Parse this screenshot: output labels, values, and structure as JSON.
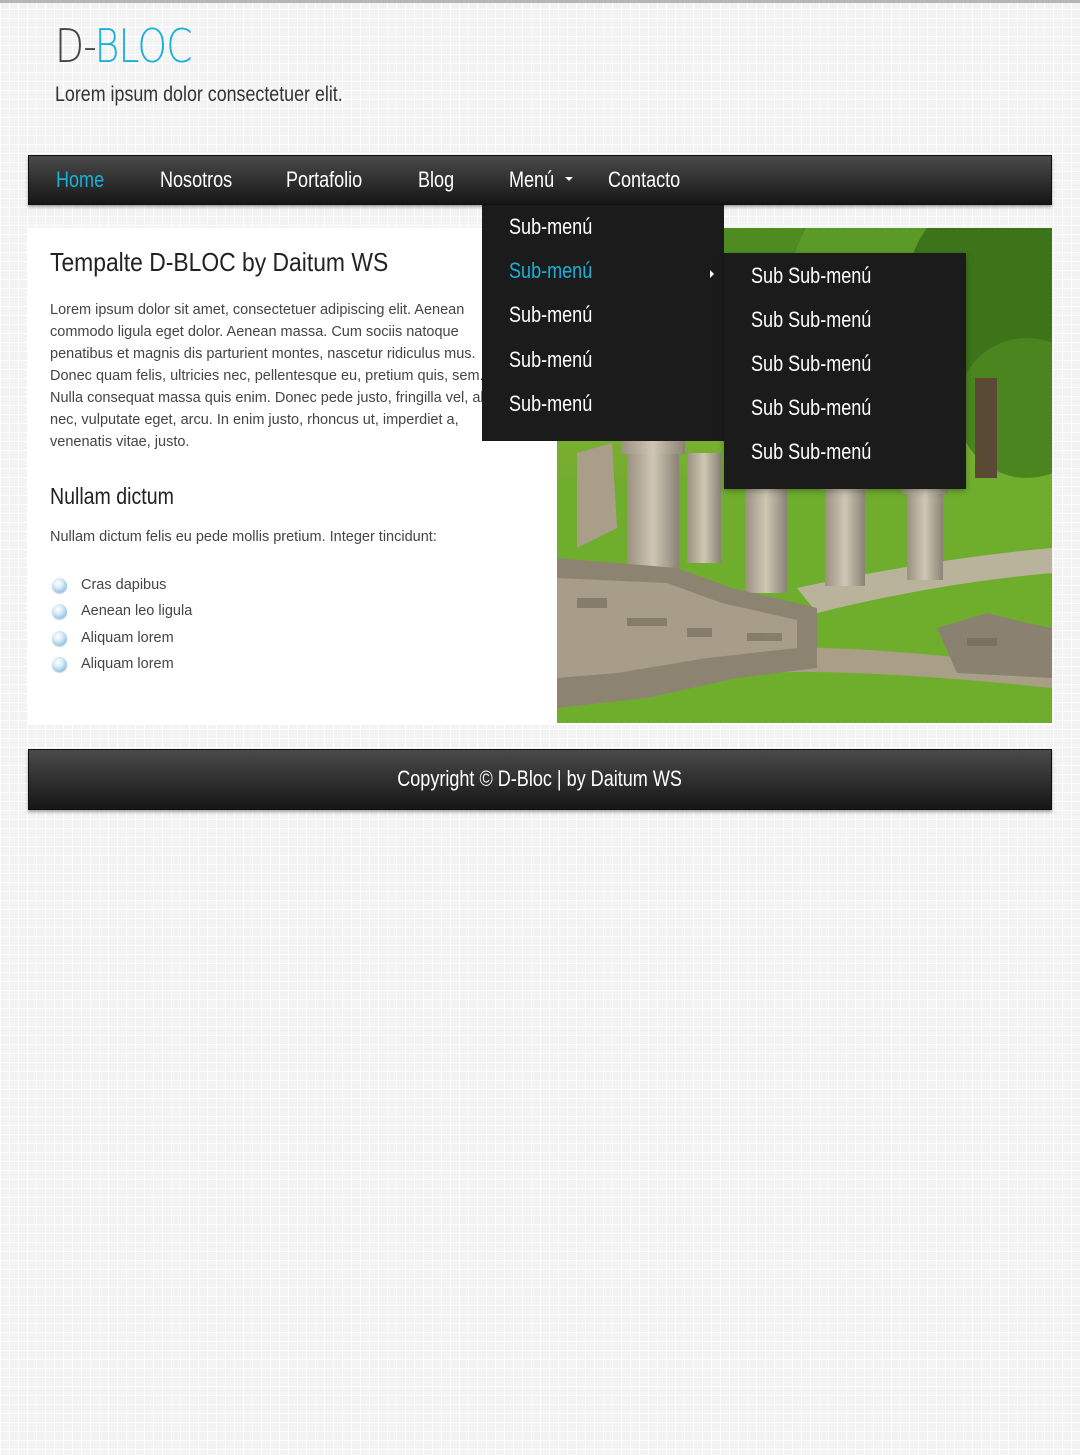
{
  "header": {
    "title_prefix": "D-",
    "title_accent": "BLOC",
    "tagline": "Lorem ipsum dolor consectetuer elit.",
    "accent_color": "#1ab0d8"
  },
  "nav": {
    "items": [
      {
        "label": "Home"
      },
      {
        "label": "Nosotros"
      },
      {
        "label": "Portafolio"
      },
      {
        "label": "Blog"
      },
      {
        "label": "Menú"
      },
      {
        "label": "Contacto"
      }
    ],
    "dropdown": [
      {
        "label": "Sub-menú"
      },
      {
        "label": "Sub-menú"
      },
      {
        "label": "Sub-menú"
      },
      {
        "label": "Sub-menú"
      },
      {
        "label": "Sub-menú"
      }
    ],
    "subdropdown": [
      {
        "label": "Sub Sub-menú"
      },
      {
        "label": "Sub Sub-menú"
      },
      {
        "label": "Sub Sub-menú"
      },
      {
        "label": "Sub Sub-menú"
      },
      {
        "label": "Sub Sub-menú"
      }
    ]
  },
  "main": {
    "title": "Tempalte D-BLOC by Daitum WS",
    "body": "Lorem ipsum dolor sit amet, consectetuer adipiscing elit. Aenean commodo ligula eget dolor. Aenean massa. Cum sociis natoque penatibus et magnis dis parturient montes, nascetur ridiculus mus. Donec quam felis, ultricies nec, pellentesque eu, pretium quis, sem. Nulla consequat massa quis enim. Donec pede justo, fringilla vel, aliquet nec, vulputate eget, arcu. In enim justo, rhoncus ut, imperdiet a, venenatis vitae, justo.",
    "section_title": "Nullam dictum",
    "section_body": "Nullam dictum felis eu pede mollis pretium. Integer tincidunt:",
    "list": [
      {
        "label": "Cras dapibus"
      },
      {
        "label": "Aenean leo ligula"
      },
      {
        "label": "Aliquam lorem"
      },
      {
        "label": "Aliquam lorem"
      }
    ]
  },
  "footer": {
    "text": "Copyright © D-Bloc | by Daitum WS"
  }
}
